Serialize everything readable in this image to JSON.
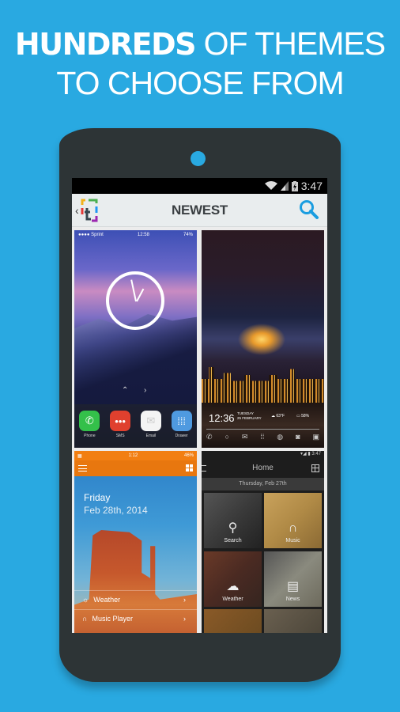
{
  "headline": {
    "line1_bold": "HUNDREDS",
    "line1_rest": "OF THEMES",
    "line2": "TO CHOOSE FROM"
  },
  "status_bar": {
    "time": "3:47",
    "icons": [
      "wifi-icon",
      "signal-icon",
      "battery-charging-icon"
    ]
  },
  "app_bar": {
    "title": "NEWEST",
    "back_icon": "chevron-left-icon",
    "logo": "app-logo",
    "search_icon": "search-icon"
  },
  "themes": [
    {
      "name": "ios-yosemite",
      "status": {
        "carrier": "●●●● Sprint",
        "time": "12:58",
        "battery": "74%"
      },
      "dock_apps": [
        {
          "label": "Phone",
          "color": "#34c04a",
          "icon": "phone-icon"
        },
        {
          "label": "SMS",
          "color": "#e0402e",
          "icon": "sms-icon"
        },
        {
          "label": "Email",
          "color": "#f4f4f4",
          "icon": "email-icon"
        },
        {
          "label": "Drawer",
          "color": "#4f9ae0",
          "icon": "drawer-icon"
        }
      ]
    },
    {
      "name": "moon-city",
      "widget": {
        "time": "12:36",
        "day": "TUESDAY",
        "date": "25 FEBRUARY",
        "temp": "63°F",
        "battery": "58%"
      },
      "dock_icons": [
        "phone-icon",
        "chat-icon",
        "mail-icon",
        "apps-icon",
        "globe-icon",
        "camera-icon",
        "gallery-icon"
      ]
    },
    {
      "name": "monument-valley",
      "status": {
        "time": "1:12",
        "battery": "46%"
      },
      "day": "Friday",
      "date": "Feb 28th, 2014",
      "rows": [
        {
          "label": "Weather",
          "icon": "sun-icon"
        },
        {
          "label": "Music Player",
          "icon": "headphones-icon"
        }
      ],
      "accent": "#f27f12"
    },
    {
      "name": "dark-home",
      "status": {
        "time": "3:47"
      },
      "title": "Home",
      "date": "Thursday, Feb 27th",
      "cells": [
        {
          "label": "Search",
          "icon": "search-icon"
        },
        {
          "label": "Music",
          "icon": "headphones-icon"
        },
        {
          "label": "Weather",
          "icon": "cloud-icon"
        },
        {
          "label": "News",
          "icon": "newspaper-icon"
        }
      ]
    }
  ],
  "colors": {
    "background": "#29a9e1",
    "phone_body": "#2d3436",
    "search_accent": "#1a9de0"
  }
}
